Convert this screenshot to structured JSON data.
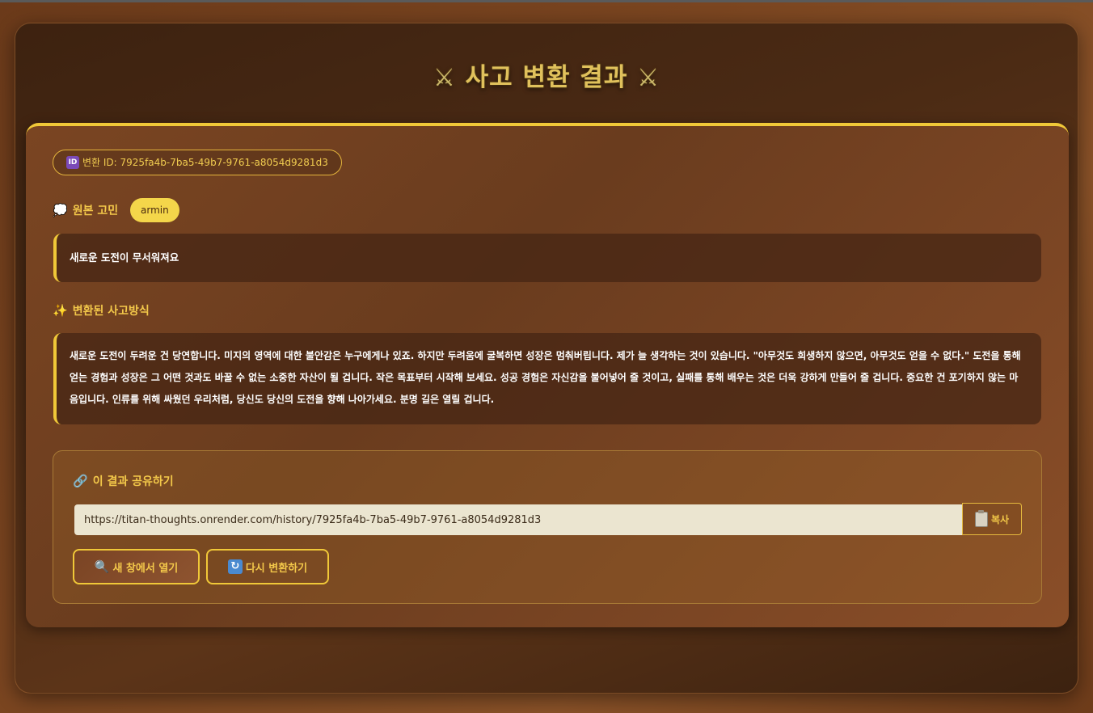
{
  "header": {
    "title": "사고 변환 결과",
    "left_icon": "crossed-swords-icon",
    "right_icon": "crossed-swords-icon"
  },
  "result": {
    "id_icon": "id-icon",
    "id_label": "변환 ID: 7925fa4b-7ba5-49b7-9761-a8054d9281d3",
    "original_section": {
      "icon": "thought-bubble-icon",
      "label": "원본 고민",
      "author": "armin",
      "text": "새로운 도전이 무서워져요"
    },
    "transformed_section": {
      "icon": "sparkles-icon",
      "label": "변환된 사고방식",
      "text": "새로운 도전이 두려운 건 당연합니다. 미지의 영역에 대한 불안감은 누구에게나 있죠. 하지만 두려움에 굴복하면 성장은 멈춰버립니다. 제가 늘 생각하는 것이 있습니다. \"아무것도 희생하지 않으면, 아무것도 얻을 수 없다.\" 도전을 통해 얻는 경험과 성장은 그 어떤 것과도 바꿀 수 없는 소중한 자산이 될 겁니다. 작은 목표부터 시작해 보세요. 성공 경험은 자신감을 불어넣어 줄 것이고, 실패를 통해 배우는 것은 더욱 강하게 만들어 줄 겁니다. 중요한 건 포기하지 않는 마음입니다. 인류를 위해 싸웠던 우리처럼, 당신도 당신의 도전을 향해 나아가세요. 분명 길은 열릴 겁니다."
    }
  },
  "share": {
    "icon": "link-icon",
    "label": "이 결과 공유하기",
    "url": "https://titan-thoughts.onrender.com/history/7925fa4b-7ba5-49b7-9761-a8054d9281d3",
    "copy_icon": "clipboard-icon",
    "copy_label": "복사",
    "open_icon": "magnifier-icon",
    "open_label": "새 창에서 열기",
    "retry_icon": "refresh-icon",
    "retry_label": "다시 변환하기"
  },
  "colors": {
    "accent": "#f0c838",
    "title_gold": "#e0c15c",
    "input_bg": "#ebe5d0"
  }
}
